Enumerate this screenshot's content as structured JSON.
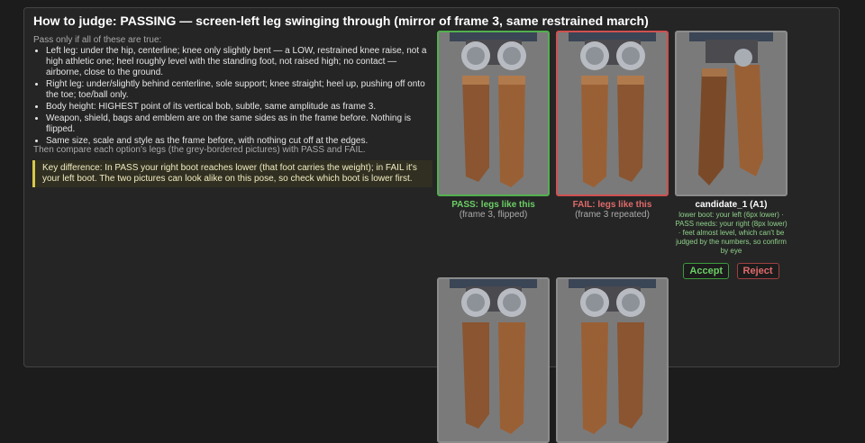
{
  "title": "How to judge: PASSING — screen-left leg swinging through (mirror of frame 3, same restrained march)",
  "intro": "Pass only if all of these are true:",
  "rules": [
    "Left leg: under the hip, centerline; knee only slightly bent — a LOW, restrained knee raise, not a high athletic one; heel roughly level with the standing foot, not raised high; no contact — airborne, close to the ground.",
    "Right leg: under/slightly behind centerline, sole support; knee straight; heel up, pushing off onto the toe; toe/ball only.",
    "Body height: HIGHEST point of its vertical bob, subtle, same amplitude as frame 3.",
    "Weapon, shield, bags and emblem are on the same sides as in the frame before. Nothing is flipped.",
    "Same size, scale and style as the frame before, with nothing cut off at the edges."
  ],
  "compare": "Then compare each option's legs (the grey-bordered pictures) with PASS and FAIL.",
  "key_difference": "Key difference: In PASS your right boot reaches lower (that foot carries the weight); in FAIL it's your left boot. The two pictures can look alike on this pose, so check which boot is lower first.",
  "cards": {
    "pass": {
      "caption": "PASS: legs like this",
      "sub": "(frame 3, flipped)"
    },
    "fail": {
      "caption": "FAIL: legs like this",
      "sub": "(frame 3 repeated)"
    },
    "candidate": {
      "caption": "candidate_1 (A1)",
      "note": "lower boot: your left (6px lower) · PASS needs: your right (8px lower) · feet almost level, which can't be judged by the numbers, so confirm by eye",
      "accept": "Accept",
      "reject": "Reject"
    }
  },
  "colors": {
    "pass": "#52b04e",
    "fail": "#d05050",
    "accent": "#d8c84a"
  }
}
